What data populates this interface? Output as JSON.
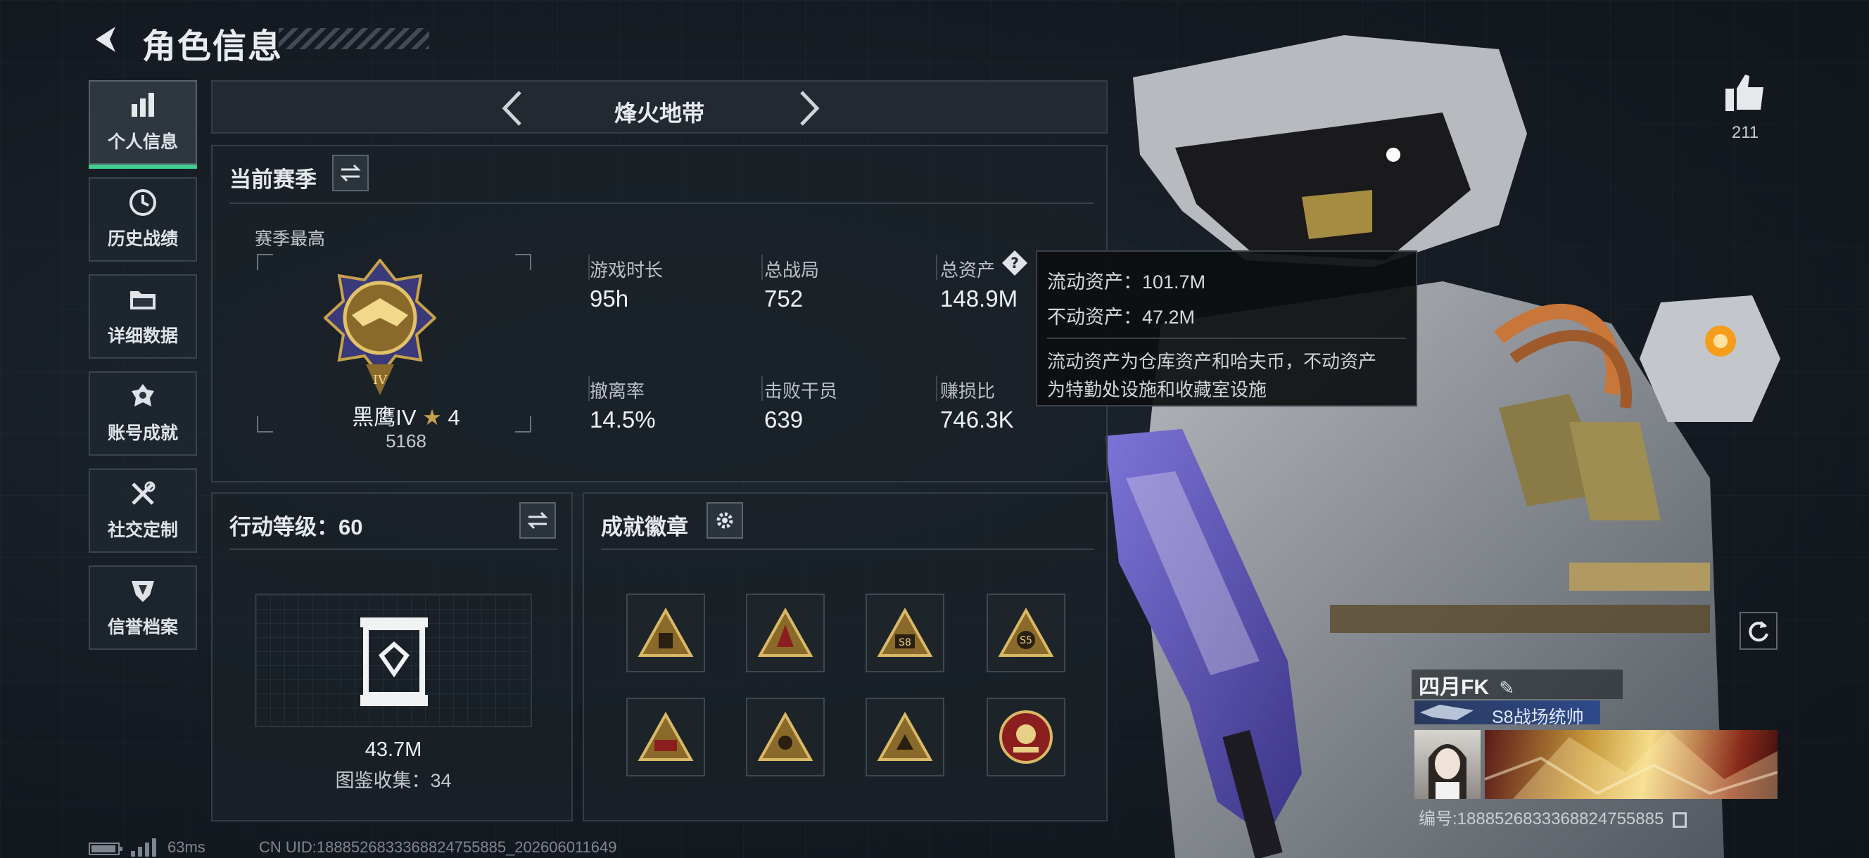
{
  "header": {
    "title": "角色信息"
  },
  "sidebar": {
    "items": [
      {
        "label": "个人信息",
        "icon": "bar-chart-icon",
        "active": true
      },
      {
        "label": "历史战绩",
        "icon": "clock-icon"
      },
      {
        "label": "详细数据",
        "icon": "folder-icon"
      },
      {
        "label": "账号成就",
        "icon": "achievement-icon"
      },
      {
        "label": "社交定制",
        "icon": "tools-icon"
      },
      {
        "label": "信誉档案",
        "icon": "shield-icon"
      }
    ]
  },
  "mode": {
    "title": "烽火地带"
  },
  "season": {
    "heading": "当前赛季",
    "best_label": "赛季最高",
    "rank_name": "黑鹰IV",
    "rank_stars": "4",
    "rank_score": "5168",
    "stats": [
      {
        "label": "游戏时长",
        "value": "95h"
      },
      {
        "label": "总战局",
        "value": "752"
      },
      {
        "label": "总资产",
        "value": "148.9M"
      },
      {
        "label": "撤离率",
        "value": "14.5%"
      },
      {
        "label": "击败干员",
        "value": "639"
      },
      {
        "label": "赚损比",
        "value": "746.3K"
      }
    ]
  },
  "tooltip": {
    "liquid": "流动资产：101.7M",
    "fixed": "不动资产：47.2M",
    "desc_line1": "流动资产为仓库资产和哈夫币，不动资产",
    "desc_line2": "为特勤处设施和收藏室设施"
  },
  "action_level": {
    "heading": "行动等级：60",
    "collection_value": "43.7M",
    "collection_label": "图鉴收集：34"
  },
  "badges": {
    "heading": "成就徽章",
    "slots": [
      {
        "label": ""
      },
      {
        "label": ""
      },
      {
        "label": "S8"
      },
      {
        "label": "S5"
      },
      {
        "label": ""
      },
      {
        "label": ""
      },
      {
        "label": ""
      },
      {
        "label": ""
      }
    ]
  },
  "likes": {
    "count": "211"
  },
  "player": {
    "name": "四月FK",
    "title": "S8战场统帅",
    "uid": "编号:1888526833368824755885"
  },
  "footer": {
    "ping": "63ms",
    "uid": "CN UID:1888526833368824755885_202606011649"
  },
  "colors": {
    "accent_green": "#3fcf8e",
    "gold": "#c8a24a",
    "badge_red": "#8b1e1e"
  }
}
